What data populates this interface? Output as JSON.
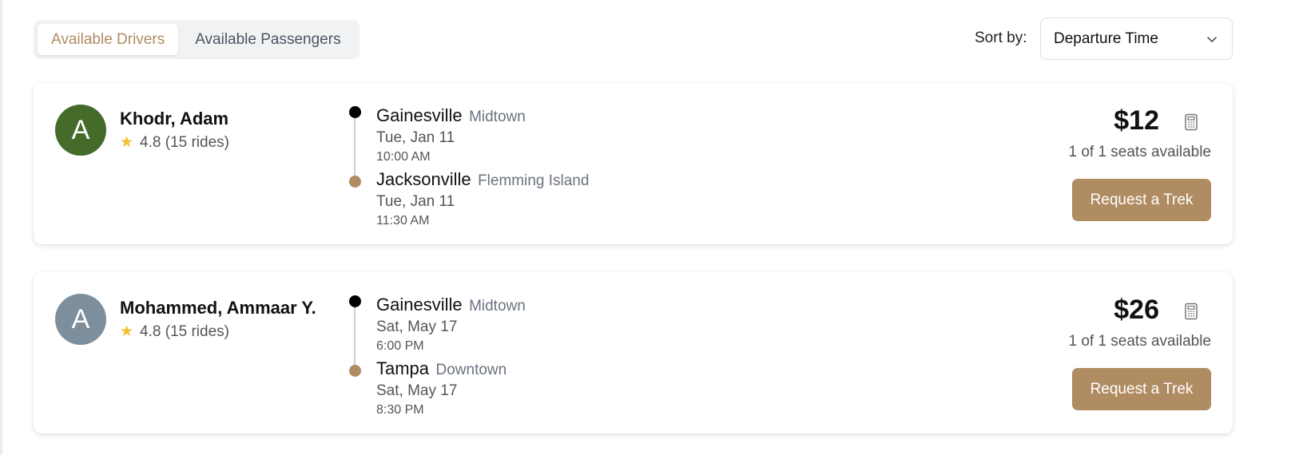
{
  "tabs": [
    {
      "label": "Available Drivers",
      "active": true
    },
    {
      "label": "Available Passengers",
      "active": false
    }
  ],
  "sort": {
    "label": "Sort by:",
    "selected": "Departure Time"
  },
  "colors": {
    "accent": "#b08c62",
    "avatar_green": "#456b2b",
    "avatar_slate": "#7d8f9d"
  },
  "drivers": [
    {
      "initial": "A",
      "avatar_color": "#456b2b",
      "name": "Khodr, Adam",
      "rating": "4.8 (15 rides)",
      "from": {
        "city": "Gainesville",
        "area": "Midtown",
        "date": "Tue, Jan 11",
        "time": "10:00 AM"
      },
      "to": {
        "city": "Jacksonville",
        "area": "Flemming Island",
        "date": "Tue, Jan 11",
        "time": "11:30 AM"
      },
      "price": "$12",
      "seats": "1 of 1 seats available",
      "button": "Request a Trek"
    },
    {
      "initial": "A",
      "avatar_color": "#7d8f9d",
      "name": "Mohammed, Ammaar Y.",
      "rating": "4.8 (15 rides)",
      "from": {
        "city": "Gainesville",
        "area": "Midtown",
        "date": "Sat, May 17",
        "time": "6:00 PM"
      },
      "to": {
        "city": "Tampa",
        "area": "Downtown",
        "date": "Sat, May 17",
        "time": "8:30 PM"
      },
      "price": "$26",
      "seats": "1 of 1 seats available",
      "button": "Request a Trek"
    }
  ],
  "icons": {
    "star": "star-icon",
    "calculator": "calculator-icon",
    "chevron": "chevron-down-icon"
  }
}
